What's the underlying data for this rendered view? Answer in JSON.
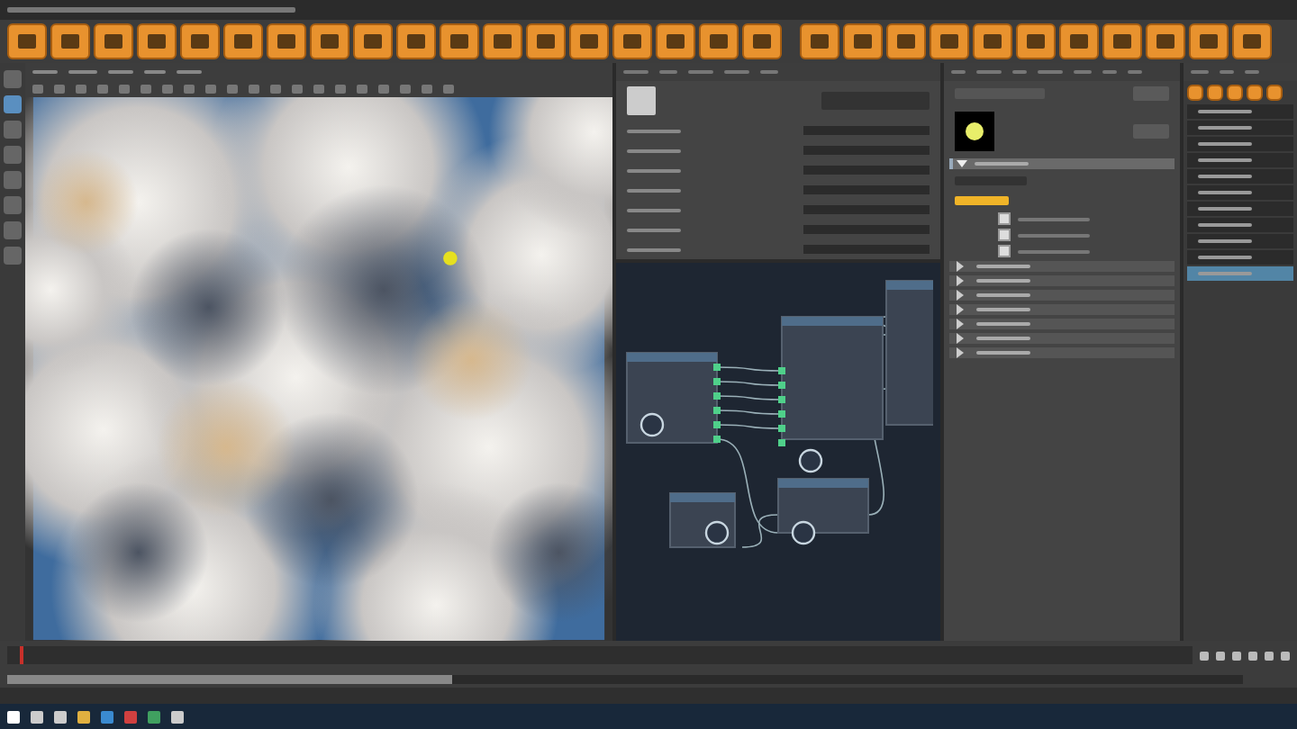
{
  "left_toolbar": {
    "tools": [
      {
        "selected": false
      },
      {
        "selected": true
      },
      {
        "selected": false
      },
      {
        "selected": false
      },
      {
        "selected": false
      },
      {
        "selected": false
      },
      {
        "selected": false
      },
      {
        "selected": false
      }
    ]
  },
  "attribute_editor": {
    "sections": [
      {
        "expanded": true
      },
      {
        "expanded": false
      },
      {
        "expanded": false
      },
      {
        "expanded": false
      },
      {
        "expanded": false
      },
      {
        "expanded": false
      },
      {
        "expanded": false
      },
      {
        "expanded": false
      }
    ],
    "checkboxes": [
      {
        "checked": true
      },
      {
        "checked": true
      },
      {
        "checked": true
      }
    ]
  },
  "outliner": {
    "rows": [
      {
        "selected": false
      },
      {
        "selected": false
      },
      {
        "selected": false
      },
      {
        "selected": false
      },
      {
        "selected": false
      },
      {
        "selected": false
      },
      {
        "selected": false
      },
      {
        "selected": false
      },
      {
        "selected": false
      },
      {
        "selected": false
      },
      {
        "selected": true
      }
    ]
  },
  "time_slider": {
    "level": 0.01
  },
  "time_range": {
    "level": 0.36
  }
}
